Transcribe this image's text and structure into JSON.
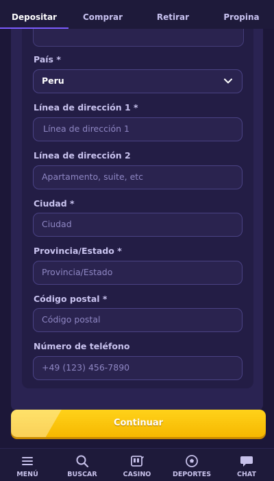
{
  "tabs": [
    {
      "label": "Depositar"
    },
    {
      "label": "Comprar"
    },
    {
      "label": "Retirar"
    },
    {
      "label": "Propina"
    }
  ],
  "form": {
    "country": {
      "label": "País *",
      "value": "Peru"
    },
    "address1": {
      "label": "Línea de dirección 1 *",
      "placeholder": "Línea de dirección 1"
    },
    "address2": {
      "label": "Línea de dirección 2",
      "placeholder": "Apartamento, suite, etc"
    },
    "city": {
      "label": "Ciudad *",
      "placeholder": "Ciudad"
    },
    "state": {
      "label": "Provincia/Estado *",
      "placeholder": "Provincia/Estado"
    },
    "postal": {
      "label": "Código postal *",
      "placeholder": "Código postal"
    },
    "phone": {
      "label": "Número de teléfono",
      "placeholder": "+49 (123) 456-7890"
    }
  },
  "continue_label": "Continuar",
  "bottom_nav": [
    {
      "label": "MENÚ",
      "icon": "menu-icon"
    },
    {
      "label": "BUSCAR",
      "icon": "search-icon"
    },
    {
      "label": "CASINO",
      "icon": "slot-machine-icon"
    },
    {
      "label": "DEPORTES",
      "icon": "soccer-ball-icon"
    },
    {
      "label": "CHAT",
      "icon": "chat-icon"
    }
  ],
  "colors": {
    "background": "#1c1738",
    "panel": "#231d45",
    "accent": "#7c5cff",
    "button": "#ffc80a"
  }
}
